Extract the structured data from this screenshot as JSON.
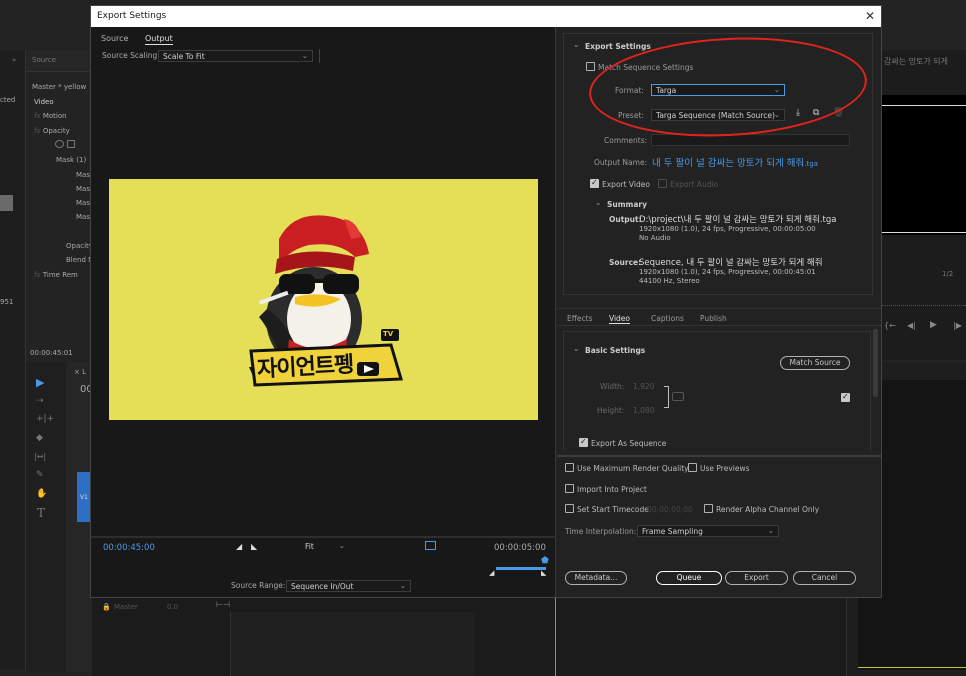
{
  "background": {
    "source_tab": "Source",
    "master_label": "Master * yellow",
    "video_label": "Video",
    "fx_items": [
      "Motion",
      "Opacity",
      "Mask (1)",
      "Mas",
      "Mas",
      "Mas",
      "Mas",
      "Opacity",
      "Blend M",
      "Time Rem"
    ],
    "left_labels": [
      "cted",
      "951"
    ],
    "timecode_left": "00:00:45:01",
    "track_v1": "V1",
    "master_row": "Master",
    "master_val": "0.0",
    "right_title": "감싸는 망토가 되게",
    "right_counter": "1/2",
    "track_letter": "00"
  },
  "dialog": {
    "title": "Export Settings",
    "close_glyph": "✕",
    "tabs": [
      "Source",
      "Output"
    ],
    "active_tab": "Output",
    "source_scaling_label": "Source Scaling:",
    "source_scaling_value": "Scale To Fit",
    "preview": {
      "logo_text": "자이언트펭",
      "tv_badge": "TV",
      "bg_color": "#e5df58"
    },
    "timecode_start": "00:00:45:00",
    "timecode_end": "00:00:05:00",
    "fit_value": "Fit",
    "source_range_label": "Source Range:",
    "source_range_value": "Sequence In/Out",
    "export_settings_header": "Export Settings",
    "match_sequence_label": "Match Sequence Settings",
    "format_label": "Format:",
    "format_value": "Targa",
    "preset_label": "Preset:",
    "preset_value": "Targa Sequence (Match Source)",
    "comments_label": "Comments:",
    "output_name_label": "Output Name:",
    "output_name_value": "내 두 팔이 널 감싸는 망토가 되게 해줘",
    "output_name_ext": ".tga",
    "export_video_label": "Export Video",
    "export_audio_label": "Export Audio",
    "summary_header": "Summary",
    "output_label": "Output:",
    "output_line1": "D:\\project\\내 두 팔이 널 감싸는 망토가 되게 해줘.tga",
    "output_line2": "1920x1080 (1.0), 24 fps, Progressive, 00:00:05:00",
    "output_line3": "No Audio",
    "source_label": "Source:",
    "source_line1": "Sequence, 내 두 팔이 널 감싸는 망토가 되게 해줘",
    "source_line2": "1920x1080 (1.0), 24 fps, Progressive, 00:00:45:01",
    "source_line3": "44100 Hz, Stereo",
    "settings_tabs": [
      "Effects",
      "Video",
      "Captions",
      "Publish"
    ],
    "active_settings_tab": "Video",
    "basic_settings_header": "Basic Settings",
    "match_source_btn": "Match Source",
    "width_label": "Width:",
    "width_value": "1,920",
    "height_label": "Height:",
    "height_value": "1,080",
    "export_as_sequence_label": "Export As Sequence",
    "max_render_label": "Use Maximum Render Quality",
    "use_previews_label": "Use Previews",
    "import_project_label": "Import Into Project",
    "set_start_tc_label": "Set Start Timecode",
    "start_tc_value": "00;00;00;00",
    "render_alpha_label": "Render Alpha Channel Only",
    "time_interp_label": "Time Interpolation:",
    "time_interp_value": "Frame Sampling",
    "metadata_btn": "Metadata...",
    "queue_btn": "Queue",
    "export_btn": "Export",
    "cancel_btn": "Cancel"
  },
  "colors": {
    "accent_blue": "#4a9ae8",
    "annotation_red": "#e0241d",
    "preview_yellow": "#e5df58"
  }
}
